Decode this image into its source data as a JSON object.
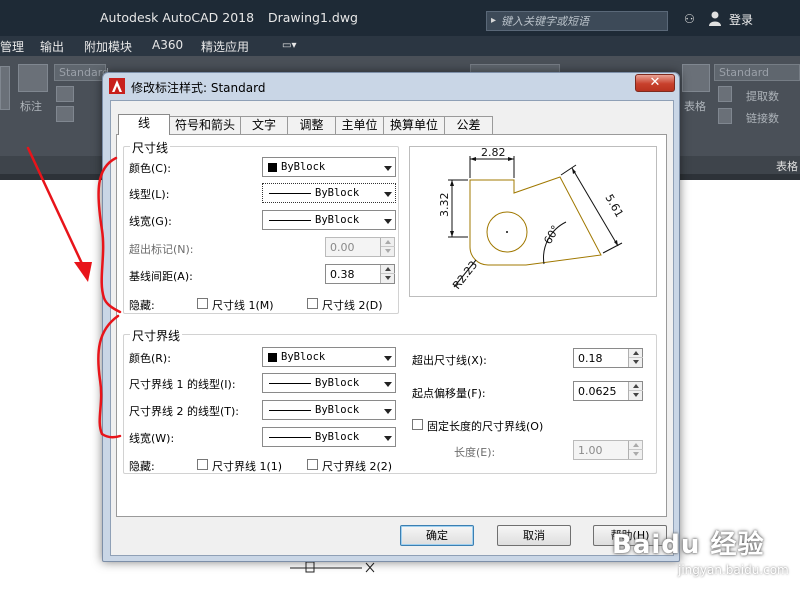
{
  "window": {
    "app_title": "Autodesk AutoCAD 2018",
    "doc_title": "Drawing1.dwg",
    "search_placeholder": "键入关键字或短语",
    "login_label": "登录"
  },
  "menubar": {
    "items": [
      "管理",
      "输出",
      "附加模块",
      "A360",
      "精选应用"
    ]
  },
  "ribbon": {
    "text_style": "Standard",
    "table_style": "Standard",
    "annotate_label": "标注",
    "table_label": "表格",
    "extract_label": "提取数",
    "link_label": "链接数",
    "grid_label": "表格",
    "footer_label": "表格"
  },
  "dialog": {
    "title": "修改标注样式: Standard",
    "close_glyph": "✕",
    "tabs": [
      "线",
      "符号和箭头",
      "文字",
      "调整",
      "主单位",
      "换算单位",
      "公差"
    ],
    "dim_lines": {
      "title": "尺寸线",
      "color_label": "颜色(C):",
      "color_value": "ByBlock",
      "linetype_label": "线型(L):",
      "linetype_value": "ByBlock",
      "lineweight_label": "线宽(G):",
      "lineweight_value": "ByBlock",
      "extend_label": "超出标记(N):",
      "extend_value": "0.00",
      "baseline_label": "基线间距(A):",
      "baseline_value": "0.38",
      "suppress_label": "隐藏:",
      "suppress_1": "尺寸线 1(M)",
      "suppress_2": "尺寸线 2(D)"
    },
    "ext_lines": {
      "title": "尺寸界线",
      "color_label": "颜色(R):",
      "color_value": "ByBlock",
      "lt1_label": "尺寸界线 1 的线型(I):",
      "lt1_value": "ByBlock",
      "lt2_label": "尺寸界线 2 的线型(T):",
      "lt2_value": "ByBlock",
      "lw_label": "线宽(W):",
      "lw_value": "ByBlock",
      "suppress_label": "隐藏:",
      "suppress_1": "尺寸界线 1(1)",
      "suppress_2": "尺寸界线 2(2)",
      "beyond_label": "超出尺寸线(X):",
      "beyond_value": "0.18",
      "offset_label": "起点偏移量(F):",
      "offset_value": "0.0625",
      "fixed_label": "固定长度的尺寸界线(O)",
      "length_label": "长度(E):",
      "length_value": "1.00"
    },
    "preview": {
      "dim_top": "2.82",
      "dim_left": "3.32",
      "dim_right": "5.61",
      "dim_angle": "60°",
      "dim_radius": "R2.23"
    },
    "buttons": {
      "ok": "确定",
      "cancel": "取消",
      "help": "帮助(H)"
    }
  },
  "watermark": {
    "brand": "Baidu 经验",
    "site": "jingyan.baidu.com"
  },
  "colors": {
    "titlebar": "#1e2a36",
    "ribbon": "#4a5058",
    "dialog_frame": "#c9d6e6",
    "annotation_red": "#e8141a",
    "preview_geometry": "#a07800"
  }
}
